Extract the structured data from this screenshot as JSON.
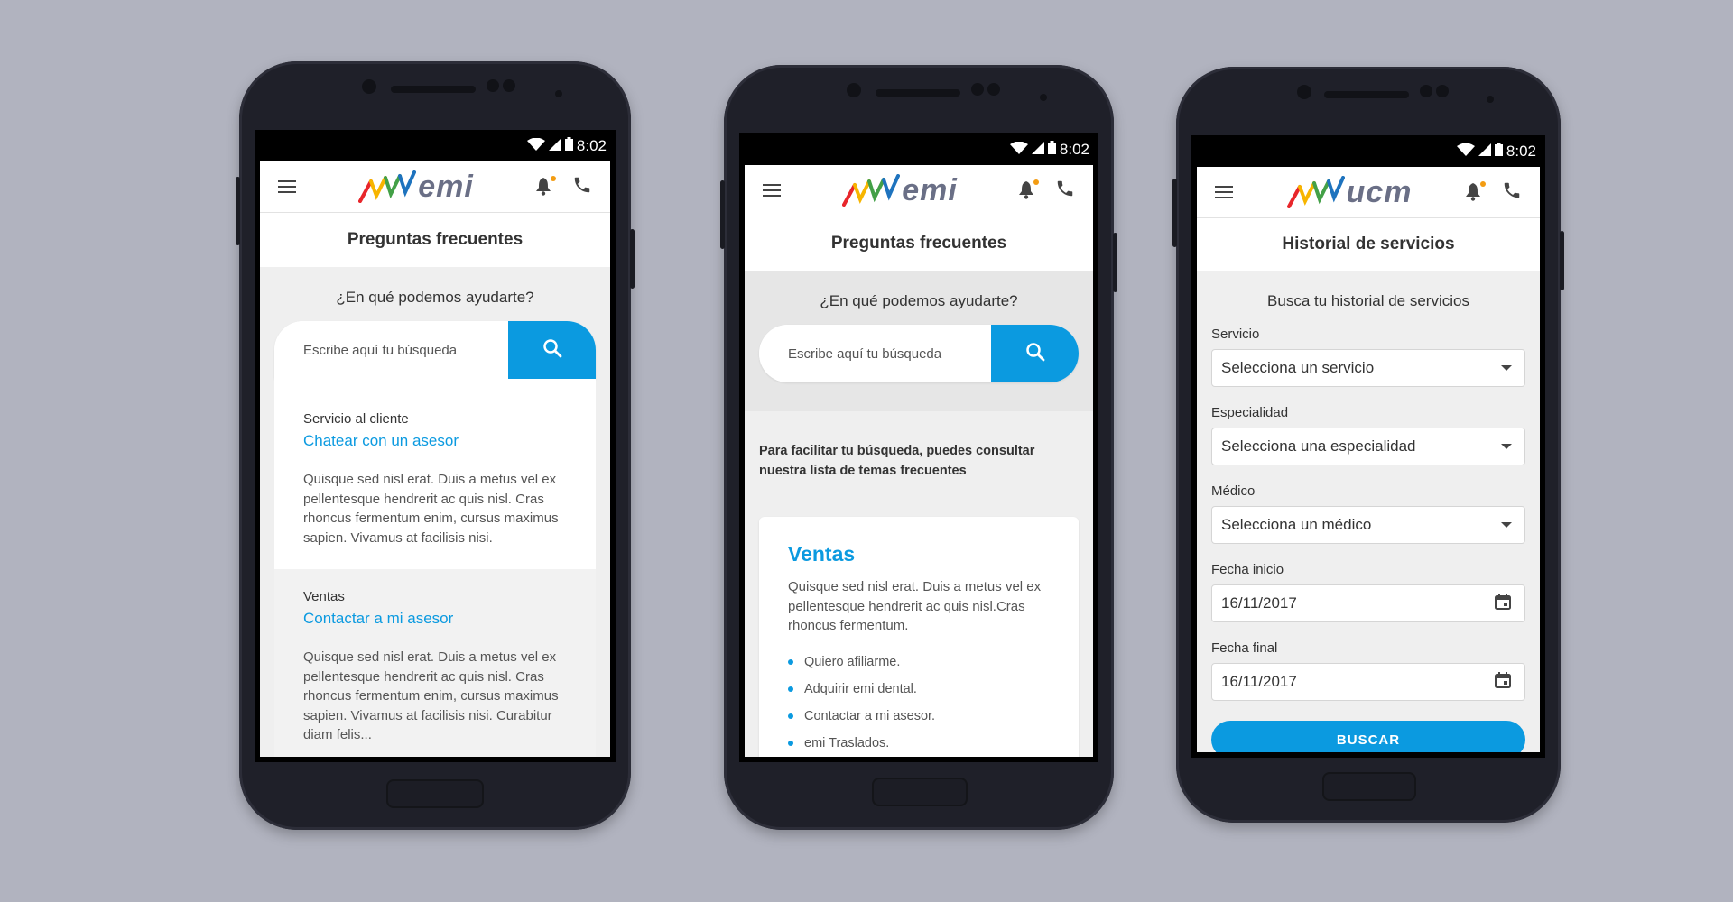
{
  "status": {
    "time": "8:02"
  },
  "phones": [
    {
      "brand": "emi",
      "page_title": "Preguntas frecuentes",
      "subheading": "¿En qué podemos ayudarte?",
      "search_placeholder": "Escribe aquí tu búsqueda",
      "faq": [
        {
          "category": "Servicio al cliente",
          "link": "Chatear con un asesor",
          "text": "Quisque sed nisl erat. Duis a metus vel ex pellentesque hendrerit ac quis nisl. Cras rhoncus fermentum enim, cursus maximus sapien. Vivamus at facilisis nisi."
        },
        {
          "category": "Ventas",
          "link": "Contactar a mi asesor",
          "text": "Quisque sed nisl erat. Duis a metus vel ex pellentesque hendrerit ac quis nisl. Cras rhoncus fermentum enim, cursus maximus sapien. Vivamus at facilisis nisi. Curabitur diam felis..."
        }
      ]
    },
    {
      "brand": "emi",
      "page_title": "Preguntas frecuentes",
      "subheading": "¿En qué podemos ayudarte?",
      "search_placeholder": "Escribe aquí tu búsqueda",
      "hint": "Para facilitar tu búsqueda, puedes consultar nuestra lista de temas frecuentes",
      "topic": {
        "title": "Ventas",
        "description": "Quisque sed nisl erat. Duis a metus vel ex pellentesque hendrerit ac quis nisl.Cras rhoncus fermentum.",
        "items": [
          "Quiero afiliarme.",
          "Adquirir emi dental.",
          "Contactar a mi asesor.",
          "emi Traslados."
        ]
      }
    },
    {
      "brand": "ucm",
      "page_title": "Historial de servicios",
      "subheading": "Busca tu historial de servicios",
      "fields": [
        {
          "label": "Servicio",
          "value": "Selecciona un servicio",
          "kind": "select"
        },
        {
          "label": "Especialidad",
          "value": "Selecciona una especialidad",
          "kind": "select"
        },
        {
          "label": "Médico",
          "value": "Selecciona un médico",
          "kind": "select"
        },
        {
          "label": "Fecha inicio",
          "value": "16/11/2017",
          "kind": "date"
        },
        {
          "label": "Fecha final",
          "value": "16/11/2017",
          "kind": "date"
        }
      ],
      "button": "BUSCAR"
    }
  ],
  "colors": {
    "accent": "#0b9ae0",
    "notification_dot": "#f39c12",
    "background": "#b1b3bf"
  },
  "icons": [
    "menu-icon",
    "bell-icon",
    "phone-icon",
    "search-icon",
    "calendar-icon",
    "wifi-icon",
    "signal-icon",
    "battery-icon"
  ]
}
